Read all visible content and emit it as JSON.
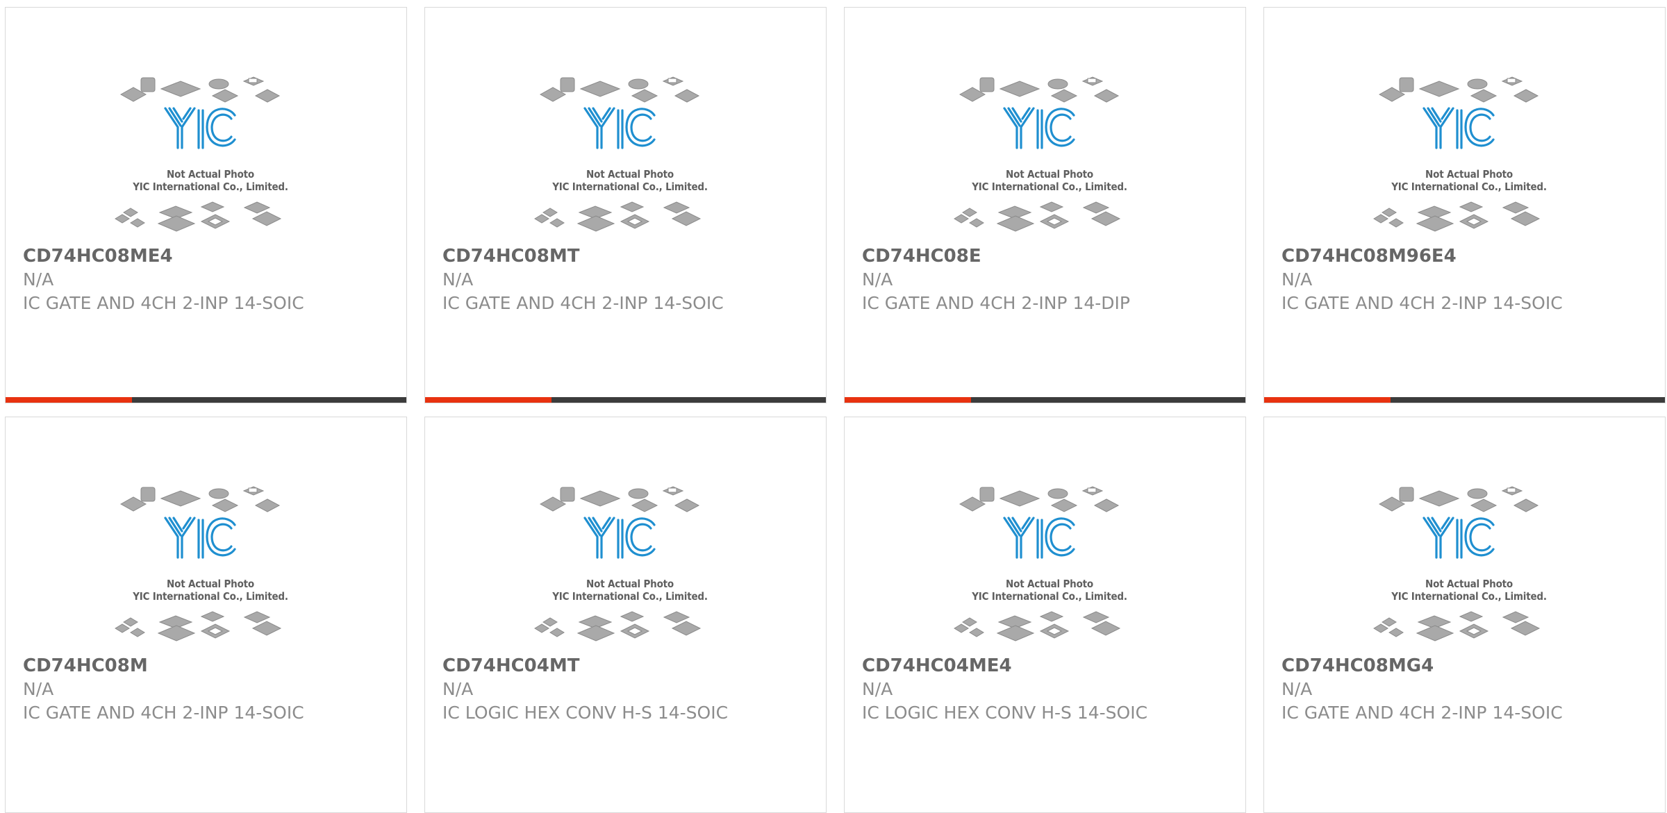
{
  "watermark": {
    "line1": "Not Actual Photo",
    "line2": "YIC International Co., Limited.",
    "logo": "YIC"
  },
  "colors": {
    "accent": "#e8320f",
    "bar": "#3c3c3c",
    "logo_blue": "#1f8fd0"
  },
  "products": [
    {
      "part": "CD74HC08ME4",
      "manufacturer": "N/A",
      "description": "IC GATE AND 4CH 2-INP 14-SOIC"
    },
    {
      "part": "CD74HC08MT",
      "manufacturer": "N/A",
      "description": "IC GATE AND 4CH 2-INP 14-SOIC"
    },
    {
      "part": "CD74HC08E",
      "manufacturer": "N/A",
      "description": "IC GATE AND 4CH 2-INP 14-DIP"
    },
    {
      "part": "CD74HC08M96E4",
      "manufacturer": "N/A",
      "description": "IC GATE AND 4CH 2-INP 14-SOIC"
    },
    {
      "part": "CD74HC08M",
      "manufacturer": "N/A",
      "description": "IC GATE AND 4CH 2-INP 14-SOIC"
    },
    {
      "part": "CD74HC04MT",
      "manufacturer": "N/A",
      "description": "IC LOGIC HEX CONV H-S 14-SOIC"
    },
    {
      "part": "CD74HC04ME4",
      "manufacturer": "N/A",
      "description": "IC LOGIC HEX CONV H-S 14-SOIC"
    },
    {
      "part": "CD74HC08MG4",
      "manufacturer": "N/A",
      "description": "IC GATE AND 4CH 2-INP 14-SOIC"
    }
  ]
}
